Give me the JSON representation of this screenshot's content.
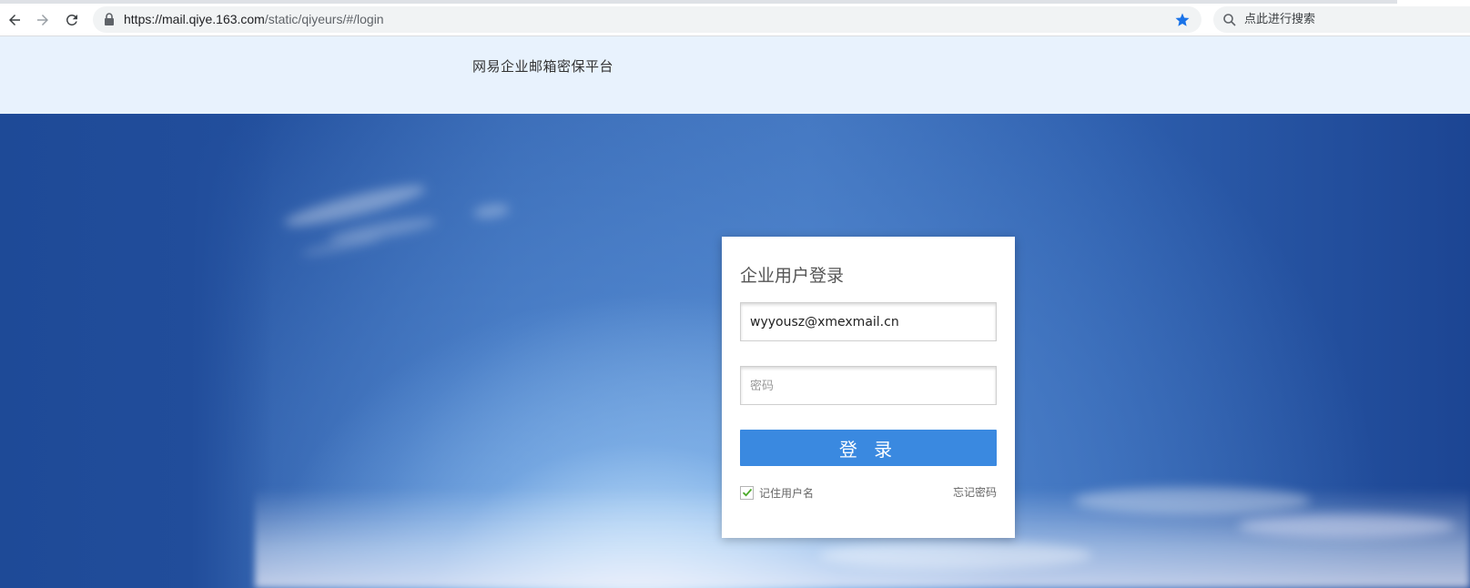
{
  "browser": {
    "url_host": "https://mail.qiye.163.com",
    "url_path": "/static/qiyeurs/#/login",
    "search_placeholder": "点此进行搜索"
  },
  "header": {
    "site_title": "网易企业邮箱密保平台"
  },
  "login": {
    "title": "企业用户登录",
    "username_value": "wyyousz@xmexmail.cn",
    "password_placeholder": "密码",
    "submit_label": "登 录",
    "remember_label": "记住用户名",
    "remember_checked": true,
    "forgot_label": "忘记密码"
  },
  "colors": {
    "accent": "#3a89e0",
    "header_bg": "#e8f2fd",
    "star": "#1a73e8"
  },
  "icons": [
    "back-arrow-icon",
    "forward-arrow-icon",
    "reload-icon",
    "lock-icon",
    "star-icon",
    "search-icon",
    "checkmark-icon"
  ]
}
